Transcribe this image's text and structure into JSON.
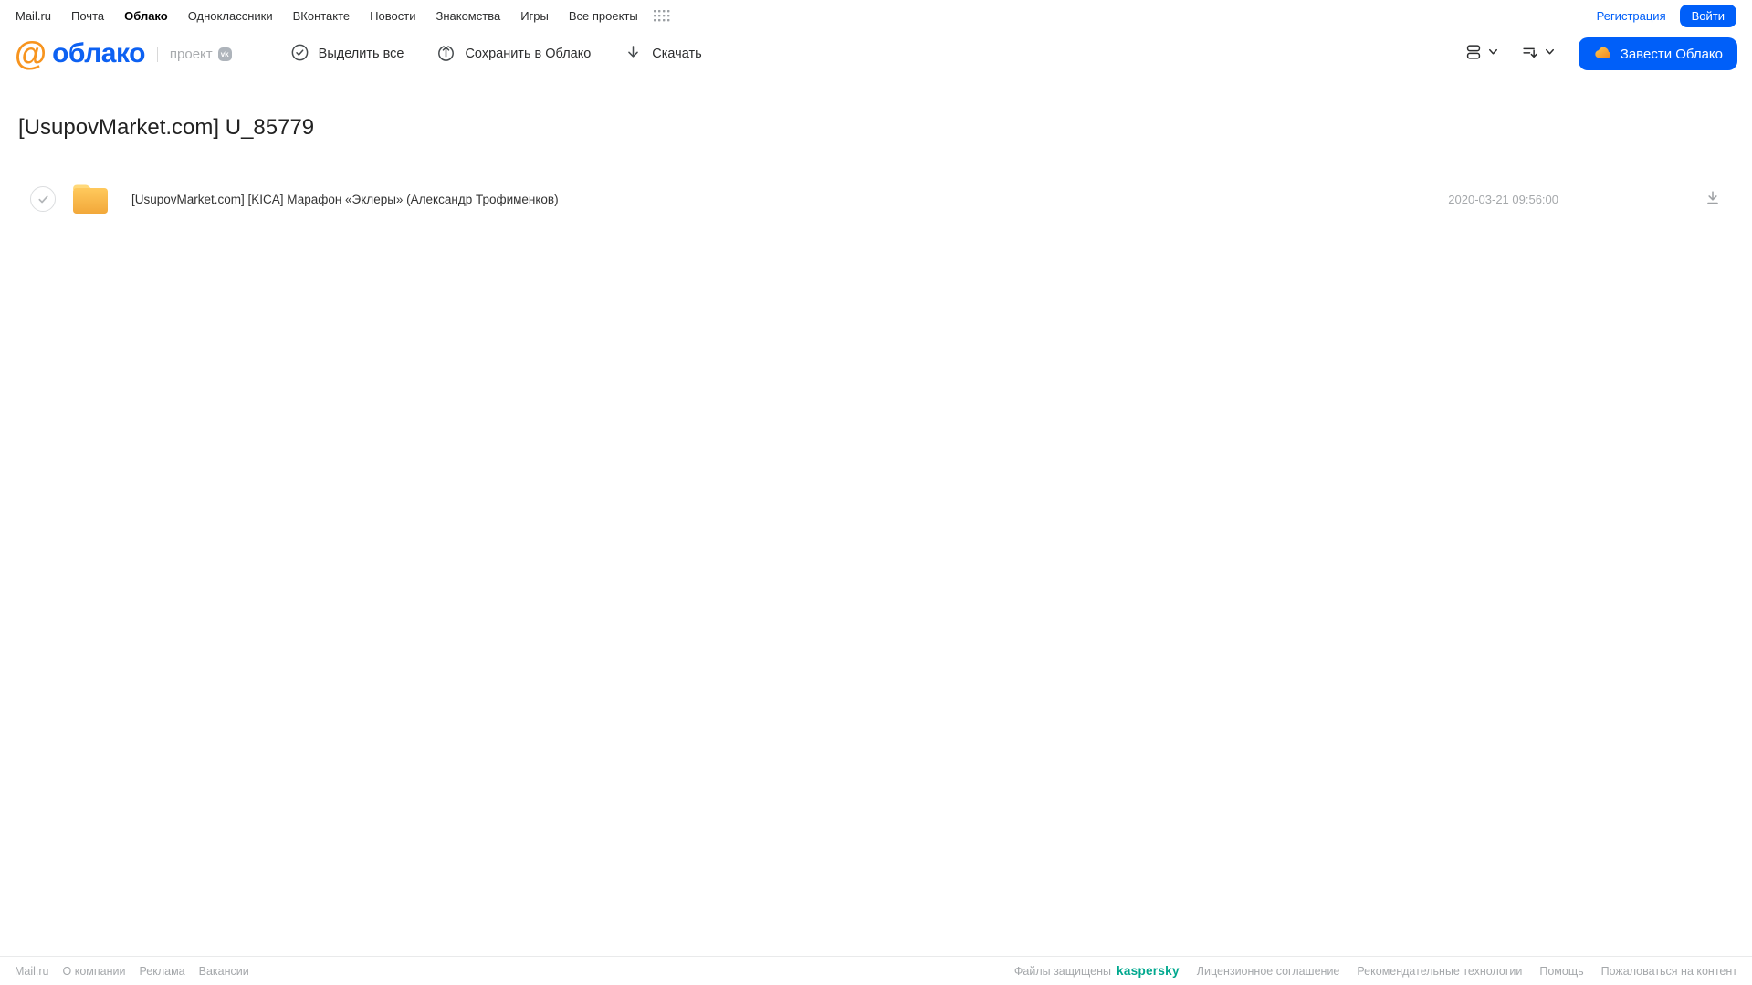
{
  "topbar": {
    "links": [
      "Mail.ru",
      "Почта",
      "Облако",
      "Одноклассники",
      "ВКонтакте",
      "Новости",
      "Знакомства",
      "Игры",
      "Все проекты"
    ],
    "active_link": "Облако",
    "register_label": "Регистрация",
    "login_label": "Войти"
  },
  "header": {
    "logo_at": "@",
    "logo_text": "облако",
    "project_label": "проект",
    "vk_badge": "vk",
    "toolbar": [
      {
        "label": "Выделить все",
        "icon": "check-circle-icon"
      },
      {
        "label": "Сохранить в Облако",
        "icon": "cloud-upload-icon"
      },
      {
        "label": "Скачать",
        "icon": "download-icon"
      }
    ],
    "view_control_icon": "view-toggle-icon",
    "sort_control_icon": "sort-icon",
    "get_cloud_label": "Завести Облако"
  },
  "main": {
    "title": "[UsupovMarket.com] U_85779",
    "files": [
      {
        "type": "folder",
        "name": "[UsupovMarket.com] [KICA] Марафон «Эклеры» (Александр Трофименков)",
        "date": "2020-03-21 09:56:00"
      }
    ]
  },
  "footer": {
    "left_links": [
      "Mail.ru",
      "О компании",
      "Реклама",
      "Вакансии"
    ],
    "protected_label": "Файлы защищены",
    "kaspersky_label": "kaspersky",
    "right_links": [
      "Лицензионное соглашение",
      "Рекомендательные технологии",
      "Помощь",
      "Пожаловаться на контент"
    ]
  },
  "colors": {
    "accent_blue": "#005FF9",
    "logo_blue": "#0D61F2",
    "logo_orange": "#F7941E",
    "folder_light": "#FFD97B",
    "folder_dark": "#F2A83A",
    "kaspersky_teal": "#00A88E",
    "muted_gray": "#A5A8AB"
  }
}
